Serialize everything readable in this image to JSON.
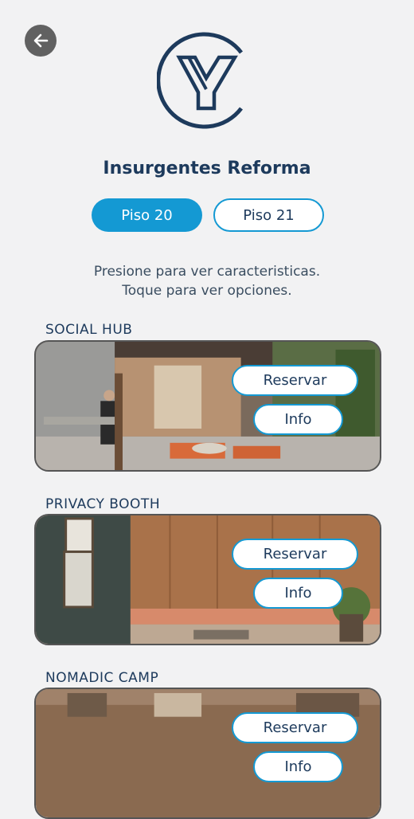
{
  "header": {
    "back_icon": "arrow-left-icon",
    "logo_icon": "building-logo-icon",
    "title": "Insurgentes Reforma"
  },
  "floors": {
    "tabs": [
      {
        "label": "Piso 20",
        "active": true
      },
      {
        "label": "Piso 21",
        "active": false
      }
    ]
  },
  "instructions": {
    "line1": "Presione para ver caracteristicas.",
    "line2": "Toque para ver opciones."
  },
  "spaces": [
    {
      "name": "SOCIAL HUB",
      "reserve_label": "Reservar",
      "info_label": "Info"
    },
    {
      "name": "PRIVACY BOOTH",
      "reserve_label": "Reservar",
      "info_label": "Info"
    },
    {
      "name": "NOMADIC CAMP",
      "reserve_label": "Reservar",
      "info_label": "Info"
    }
  ],
  "colors": {
    "accent": "#1499d3",
    "navy": "#1d3a5c",
    "background": "#f2f2f3"
  }
}
